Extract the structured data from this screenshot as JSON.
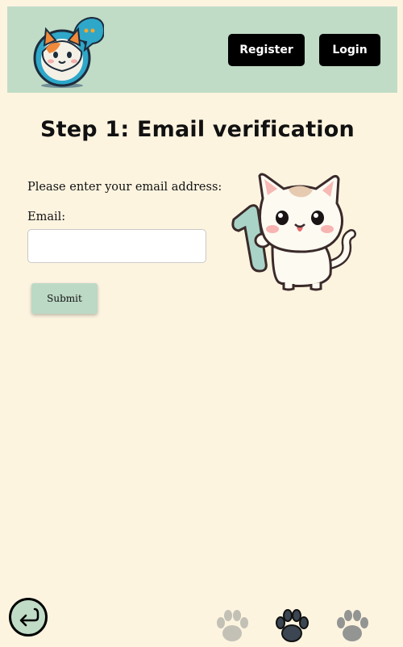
{
  "header": {
    "logo_icon": "cat-chat-logo-icon",
    "register_label": "Register",
    "login_label": "Login"
  },
  "main": {
    "title": "Step 1: Email verification",
    "prompt": "Please enter your email address:",
    "email_label": "Email:",
    "email_value": "",
    "submit_label": "Submit",
    "illustration": "cat-holding-number-one-icon"
  },
  "footer": {
    "back_icon": "back-arrow-icon",
    "progress": {
      "current_step": 2,
      "total_steps": 3
    }
  },
  "colors": {
    "background": "#fdf4e0",
    "header": "#c0dcc6",
    "accent": "#bcd9c5",
    "button_dark": "#000000"
  }
}
